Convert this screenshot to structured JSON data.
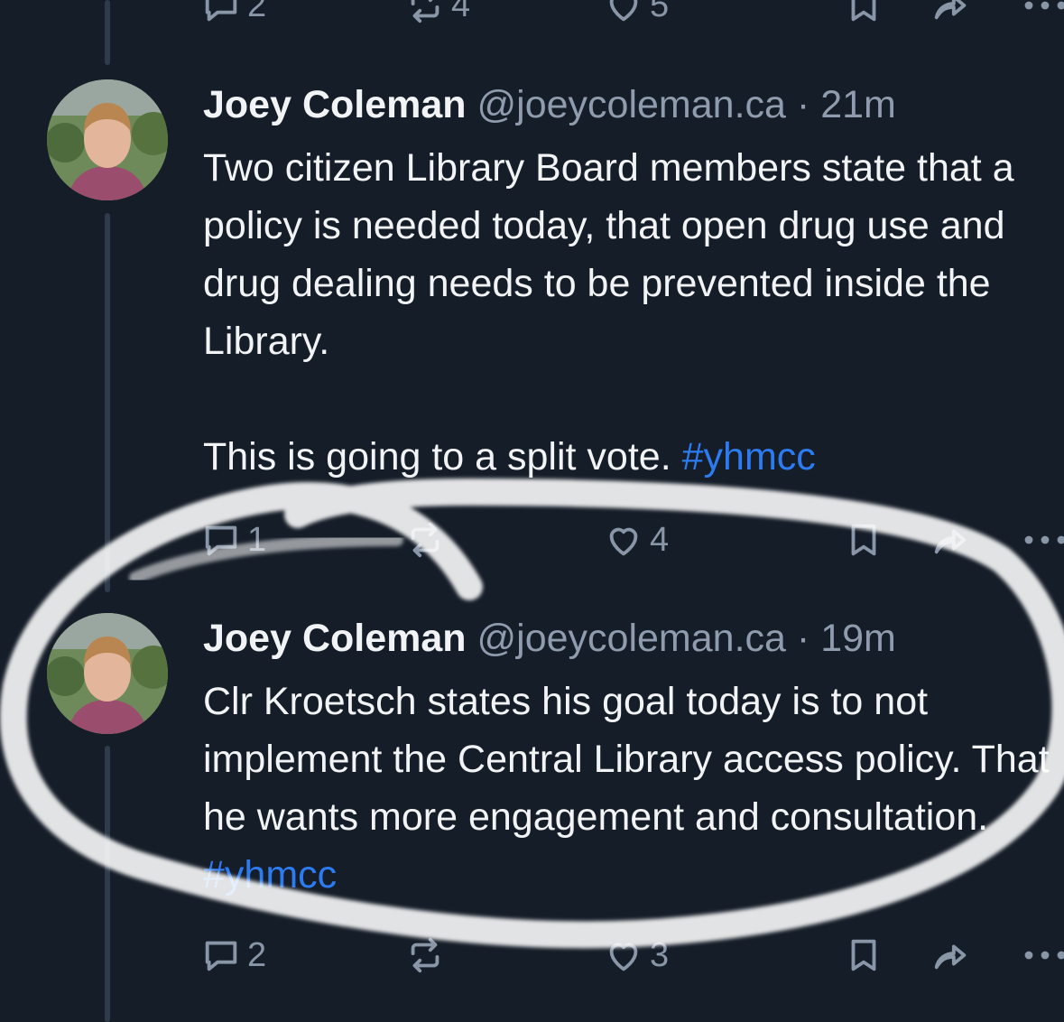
{
  "posts": [
    {
      "actions": {
        "reply_count": "2",
        "repost_count": "4",
        "like_count": "5"
      }
    },
    {
      "author": {
        "name": "Joey Coleman",
        "handle": "@joeycoleman.ca",
        "separator": "·",
        "time": "21m"
      },
      "text": {
        "line1": "Two citizen Library Board members state that a policy is needed today, that open drug use and drug dealing needs to be prevented inside the Library.",
        "line2": "This is going to a split vote.",
        "hashtag": "#yhmcc"
      },
      "actions": {
        "reply_count": "1",
        "like_count": "4"
      }
    },
    {
      "author": {
        "name": "Joey Coleman",
        "handle": "@joeycoleman.ca",
        "separator": "·",
        "time": "19m"
      },
      "text": {
        "line1": "Clr Kroetsch states his goal today is to not implement the Central Library access policy. That he wants more engagement and consultation.",
        "hashtag": "#yhmcc"
      },
      "actions": {
        "reply_count": "2",
        "like_count": "3"
      }
    }
  ],
  "icons": {
    "reply": "reply-bubble-icon",
    "repost": "repost-arrows-icon",
    "like": "heart-icon",
    "save": "bookmark-icon",
    "share": "share-arrow-icon",
    "more": "more-dots-icon"
  },
  "colors": {
    "background": "#151d28",
    "hashtag": "#2d7bf0",
    "muted": "#8896a8",
    "annotation": "#ffffff"
  }
}
